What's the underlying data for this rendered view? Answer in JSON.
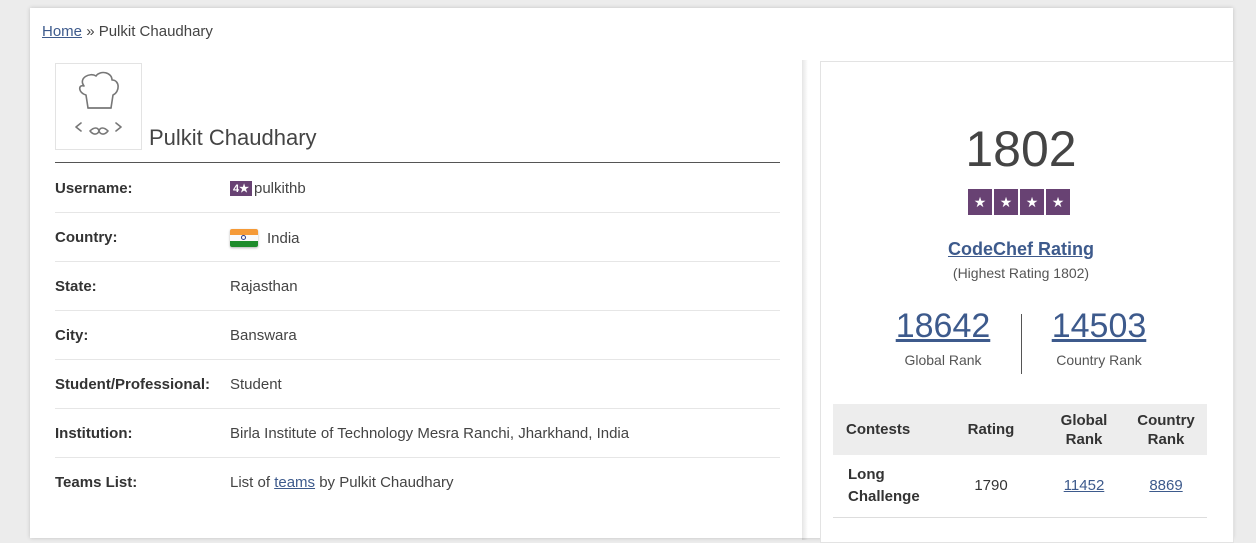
{
  "breadcrumb": {
    "home": "Home",
    "separator": "»",
    "current": "Pulkit Chaudhary"
  },
  "profile": {
    "name": "Pulkit Chaudhary",
    "rows": {
      "username": {
        "label": "Username:",
        "badge": "4★",
        "value": "pulkithb"
      },
      "country": {
        "label": "Country:",
        "value": "India"
      },
      "state": {
        "label": "State:",
        "value": "Rajasthan"
      },
      "city": {
        "label": "City:",
        "value": "Banswara"
      },
      "student": {
        "label": "Student/Professional:",
        "value": "Student"
      },
      "institution": {
        "label": "Institution:",
        "value": "Birla Institute of Technology Mesra Ranchi, Jharkhand, India"
      },
      "teams": {
        "label": "Teams List:",
        "prefix": "List of ",
        "link": "teams",
        "suffix": " by Pulkit Chaudhary"
      }
    }
  },
  "rating": {
    "value": "1802",
    "stars": [
      "★",
      "★",
      "★",
      "★"
    ],
    "title": "CodeChef Rating",
    "highest": "(Highest Rating 1802)",
    "global_rank": {
      "value": "18642",
      "label": "Global Rank"
    },
    "country_rank": {
      "value": "14503",
      "label": "Country Rank"
    }
  },
  "contests_table": {
    "headers": [
      "Contests",
      "Rating",
      "Global Rank",
      "Country Rank"
    ],
    "rows": [
      {
        "contest": "Long Challenge",
        "rating": "1790",
        "global": "11452",
        "country": "8869"
      }
    ]
  },
  "colors": {
    "brand_purple": "#684273",
    "link_blue": "#3d5a8c"
  }
}
